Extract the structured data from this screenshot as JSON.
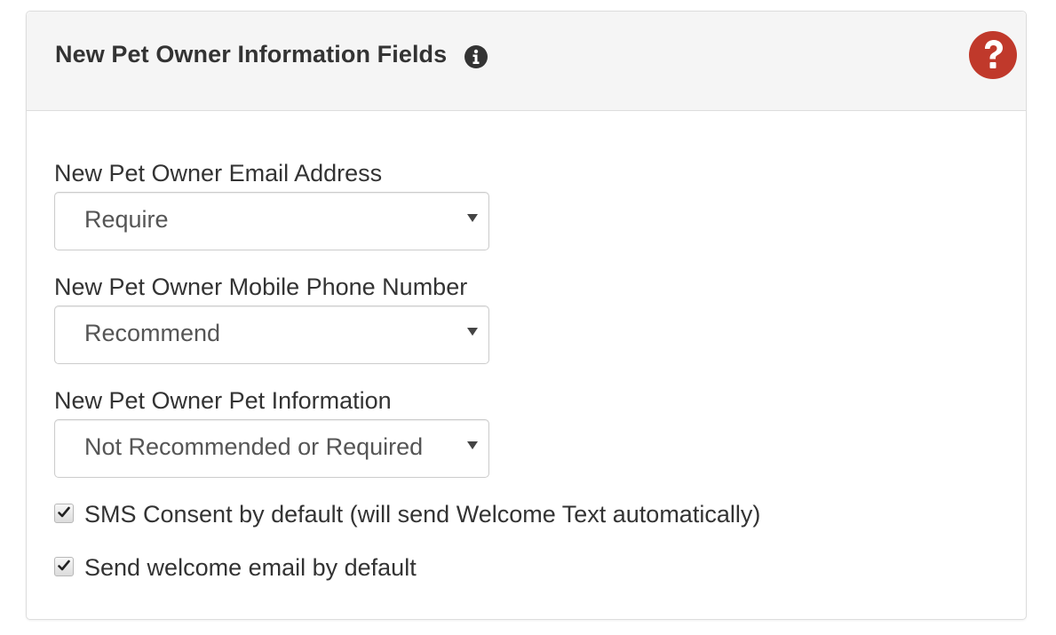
{
  "panel": {
    "title": "New Pet Owner Information Fields",
    "info_icon": "info-circle-icon",
    "help_icon": "question-circle-icon",
    "help_color": "#c0392b"
  },
  "fields": [
    {
      "label": "New Pet Owner Email Address",
      "value": "Require"
    },
    {
      "label": "New Pet Owner Mobile Phone Number",
      "value": "Recommend"
    },
    {
      "label": "New Pet Owner Pet Information",
      "value": "Not Recommended or Required"
    }
  ],
  "checkboxes": [
    {
      "label": "SMS Consent by default (will send Welcome Text automatically)",
      "checked": true
    },
    {
      "label": "Send welcome email by default",
      "checked": true
    }
  ]
}
